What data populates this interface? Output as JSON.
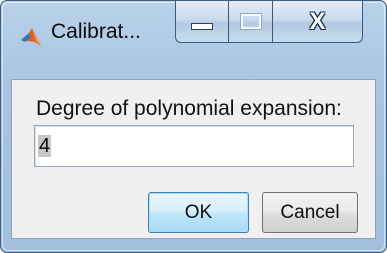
{
  "window": {
    "title": "Calibrat...",
    "close_symbol": "X",
    "app_icon": "matlab-icon"
  },
  "dialog": {
    "prompt": "Degree of polynomial expansion:",
    "input_value": "4"
  },
  "buttons": {
    "ok": "OK",
    "cancel": "Cancel"
  },
  "colors": {
    "frame": "#a9c4e2",
    "client": "#f0f0f0",
    "ok_border": "#3c7fb1"
  }
}
